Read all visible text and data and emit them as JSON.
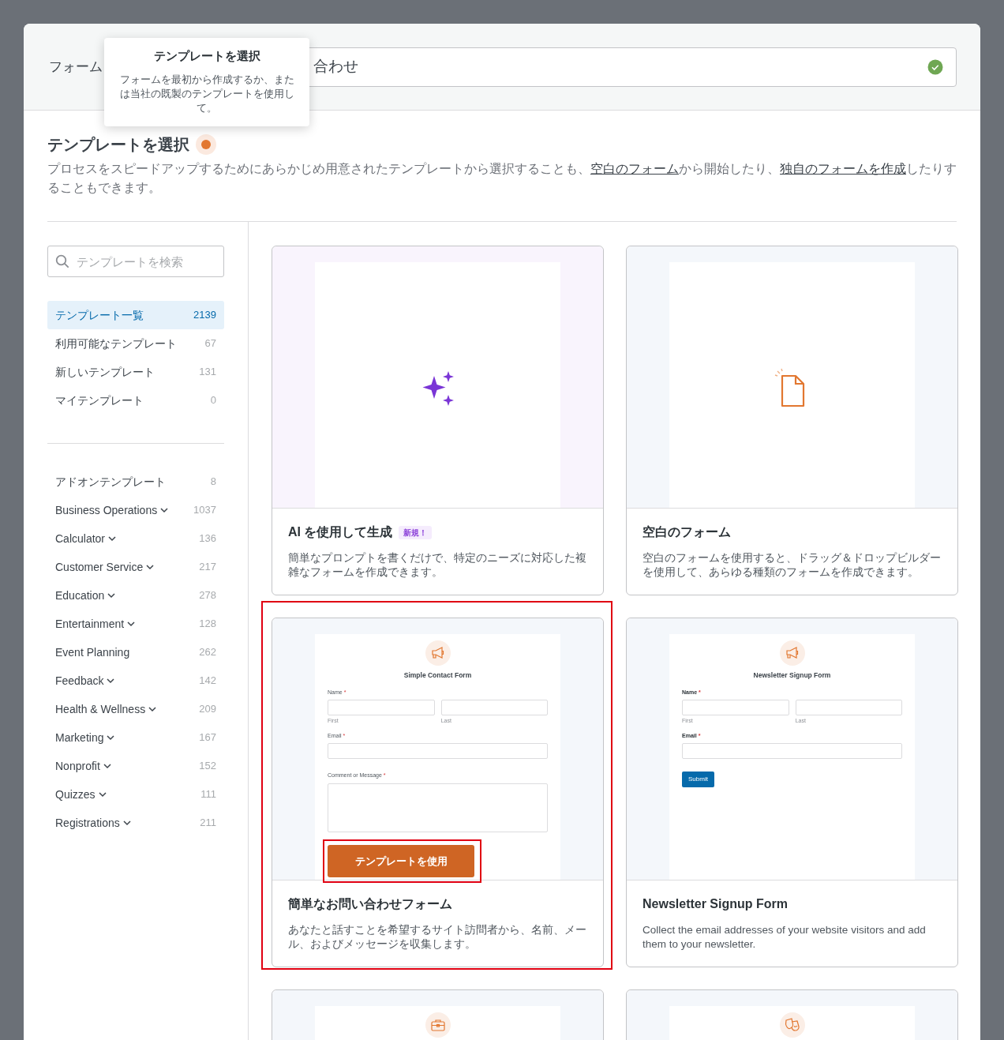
{
  "header": {
    "label": "フォーム",
    "value": "合わせ",
    "valid": true
  },
  "tooltip": {
    "title": "テンプレートを選択",
    "text": "フォームを最初から作成するか、または当社の既製のテンプレートを使用して。"
  },
  "heading": "テンプレートを選択",
  "description": [
    {
      "kind": "text",
      "text": "プロセスをスピードアップするためにあらかじめ用意されたテンプレートから選択することも、"
    },
    {
      "kind": "link",
      "text": "空白のフォーム"
    },
    {
      "kind": "text",
      "text": "から開始したり、"
    },
    {
      "kind": "link",
      "text": "独自のフォームを作成"
    },
    {
      "kind": "text",
      "text": "したりすることもできます。"
    }
  ],
  "search": {
    "placeholder": "テンプレートを検索"
  },
  "groups": [
    {
      "items": [
        {
          "label": "テンプレート一覧",
          "count": "2139",
          "selected": true,
          "has_submenu": false
        },
        {
          "label": "利用可能なテンプレート",
          "count": "67",
          "selected": false,
          "has_submenu": false
        },
        {
          "label": "新しいテンプレート",
          "count": "131",
          "selected": false,
          "has_submenu": false
        },
        {
          "label": "マイテンプレート",
          "count": "0",
          "selected": false,
          "has_submenu": false
        }
      ]
    },
    {
      "items": [
        {
          "label": "アドオンテンプレート",
          "count": "8",
          "selected": false,
          "has_submenu": false
        },
        {
          "label": "Business Operations",
          "count": "1037",
          "selected": false,
          "has_submenu": true
        },
        {
          "label": "Calculator",
          "count": "136",
          "selected": false,
          "has_submenu": true
        },
        {
          "label": "Customer Service",
          "count": "217",
          "selected": false,
          "has_submenu": true
        },
        {
          "label": "Education",
          "count": "278",
          "selected": false,
          "has_submenu": true
        },
        {
          "label": "Entertainment",
          "count": "128",
          "selected": false,
          "has_submenu": true
        },
        {
          "label": "Event Planning",
          "count": "262",
          "selected": false,
          "has_submenu": false
        },
        {
          "label": "Feedback",
          "count": "142",
          "selected": false,
          "has_submenu": true
        },
        {
          "label": "Health & Wellness",
          "count": "209",
          "selected": false,
          "has_submenu": true
        },
        {
          "label": "Marketing",
          "count": "167",
          "selected": false,
          "has_submenu": true
        },
        {
          "label": "Nonprofit",
          "count": "152",
          "selected": false,
          "has_submenu": true
        },
        {
          "label": "Quizzes",
          "count": "111",
          "selected": false,
          "has_submenu": true
        },
        {
          "label": "Registrations",
          "count": "211",
          "selected": false,
          "has_submenu": true
        }
      ]
    }
  ],
  "cards": [
    {
      "kind": "ai",
      "title": "AI を使用して生成",
      "badge": "新規！",
      "text": "簡単なプロンプトを書くだけで、特定のニーズに対応した複雑なフォームを作成できます。",
      "highlighted": false
    },
    {
      "kind": "blank",
      "title": "空白のフォーム",
      "text": "空白のフォームを使用すると、ドラッグ＆ドロップビルダーを使用して、あらゆる種類のフォームを作成できます。",
      "highlighted": false
    },
    {
      "kind": "form",
      "title": "簡単なお問い合わせフォーム",
      "text": "あなたと話すことを希望するサイト訪問者から、名前、メール、およびメッセージを収集します。",
      "highlighted": true,
      "preview": {
        "title": "Simple Contact Form",
        "bold_labels": false,
        "fields": [
          {
            "kind": "name",
            "label": "Name",
            "required_mark": "*",
            "sublabels": [
              "First",
              "Last"
            ]
          },
          {
            "kind": "email",
            "label": "Email",
            "required_mark": "*"
          },
          {
            "kind": "textarea",
            "label": "Comment or Message",
            "required_mark": "*"
          }
        ],
        "use_button": "テンプレートを使用"
      }
    },
    {
      "kind": "form",
      "title": "Newsletter Signup Form",
      "text": "Collect the email addresses of your website visitors and add them to your newsletter.",
      "highlighted": false,
      "preview": {
        "title": "Newsletter Signup Form",
        "bold_labels": true,
        "fields": [
          {
            "kind": "name",
            "label": "Name",
            "required_mark": "*",
            "sublabels": [
              "First",
              "Last"
            ]
          },
          {
            "kind": "email",
            "label": "Email",
            "required_mark": "*"
          }
        ],
        "submit": "Submit"
      }
    },
    {
      "kind": "cut_off",
      "highlighted": false
    },
    {
      "kind": "cut_off",
      "highlighted": false
    }
  ]
}
